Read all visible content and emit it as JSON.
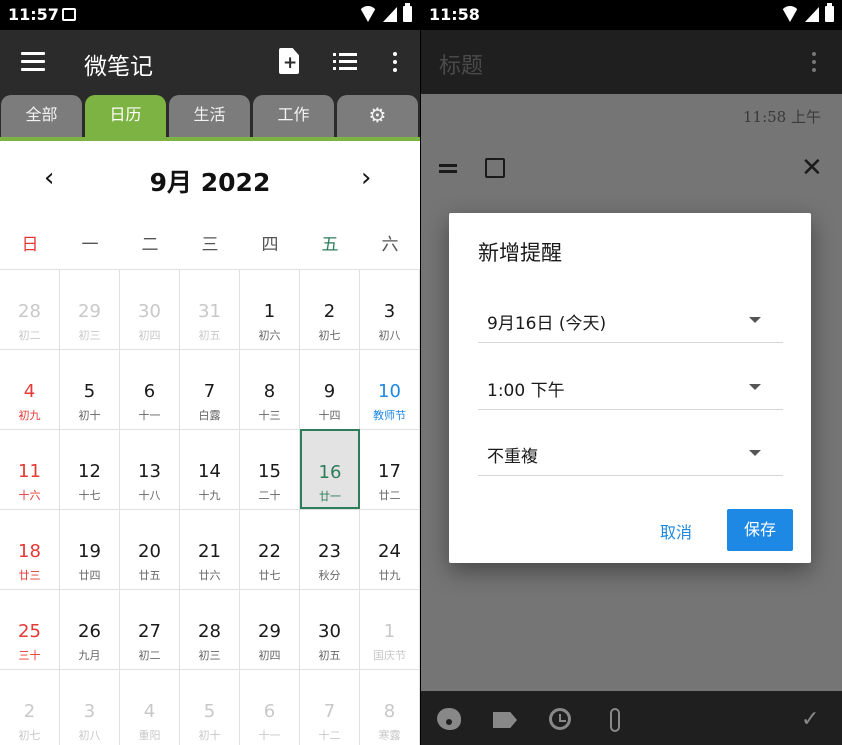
{
  "left": {
    "status": {
      "time": "11:57"
    },
    "app_title": "微笔记",
    "tabs": [
      {
        "label": "全部"
      },
      {
        "label": "日历",
        "active": true
      },
      {
        "label": "生活"
      },
      {
        "label": "工作"
      },
      {
        "label": "⚙",
        "icon": "gear-icon"
      }
    ],
    "month": {
      "prev": "‹",
      "title": "9月 2022",
      "next": "›"
    },
    "weekdays": [
      "日",
      "一",
      "二",
      "三",
      "四",
      "五",
      "六"
    ],
    "weekday_colors": {
      "sunday": "#e53935",
      "friday": "#2e7d5b"
    },
    "weeks": [
      [
        {
          "day": "28",
          "lunar": "初二",
          "other": true
        },
        {
          "day": "29",
          "lunar": "初三",
          "other": true
        },
        {
          "day": "30",
          "lunar": "初四",
          "other": true
        },
        {
          "day": "31",
          "lunar": "初五",
          "other": true
        },
        {
          "day": "1",
          "lunar": "初六"
        },
        {
          "day": "2",
          "lunar": "初七"
        },
        {
          "day": "3",
          "lunar": "初八"
        }
      ],
      [
        {
          "day": "4",
          "lunar": "初九",
          "sunday": true
        },
        {
          "day": "5",
          "lunar": "初十"
        },
        {
          "day": "6",
          "lunar": "十一"
        },
        {
          "day": "7",
          "lunar": "白露"
        },
        {
          "day": "8",
          "lunar": "十三"
        },
        {
          "day": "9",
          "lunar": "十四"
        },
        {
          "day": "10",
          "lunar": "教师节",
          "holiday": true
        }
      ],
      [
        {
          "day": "11",
          "lunar": "十六",
          "sunday": true
        },
        {
          "day": "12",
          "lunar": "十七"
        },
        {
          "day": "13",
          "lunar": "十八"
        },
        {
          "day": "14",
          "lunar": "十九"
        },
        {
          "day": "15",
          "lunar": "二十"
        },
        {
          "day": "16",
          "lunar": "廿一",
          "today": true
        },
        {
          "day": "17",
          "lunar": "廿二"
        }
      ],
      [
        {
          "day": "18",
          "lunar": "廿三",
          "sunday": true
        },
        {
          "day": "19",
          "lunar": "廿四"
        },
        {
          "day": "20",
          "lunar": "廿五"
        },
        {
          "day": "21",
          "lunar": "廿六"
        },
        {
          "day": "22",
          "lunar": "廿七"
        },
        {
          "day": "23",
          "lunar": "秋分"
        },
        {
          "day": "24",
          "lunar": "廿九"
        }
      ],
      [
        {
          "day": "25",
          "lunar": "三十",
          "sunday": true
        },
        {
          "day": "26",
          "lunar": "九月"
        },
        {
          "day": "27",
          "lunar": "初二"
        },
        {
          "day": "28",
          "lunar": "初三"
        },
        {
          "day": "29",
          "lunar": "初四"
        },
        {
          "day": "30",
          "lunar": "初五"
        },
        {
          "day": "1",
          "lunar": "国庆节",
          "other": true
        }
      ],
      [
        {
          "day": "2",
          "lunar": "初七",
          "other": true
        },
        {
          "day": "3",
          "lunar": "初八",
          "other": true
        },
        {
          "day": "4",
          "lunar": "重阳",
          "other": true
        },
        {
          "day": "5",
          "lunar": "初十",
          "other": true
        },
        {
          "day": "6",
          "lunar": "十一",
          "other": true
        },
        {
          "day": "7",
          "lunar": "十二",
          "other": true
        },
        {
          "day": "8",
          "lunar": "寒露",
          "other": true
        }
      ]
    ],
    "colors": {
      "accent": "#7cb342",
      "toolbar": "#2b2b2b",
      "today": "#2e7d5b",
      "sunday": "#e53935",
      "holiday": "#1e88e5"
    }
  },
  "right": {
    "status": {
      "time": "11:58"
    },
    "title_placeholder": "标题",
    "timestamp": "11:58 上午",
    "dialog": {
      "title": "新增提醒",
      "date": "9月16日 (今天)",
      "time": "1:00 下午",
      "repeat": "不重複",
      "cancel": "取消",
      "save": "保存"
    },
    "bottom_icons": [
      "palette-icon",
      "label-icon",
      "alarm-icon",
      "attach-icon",
      "check-icon"
    ],
    "colors": {
      "button": "#1e88e5",
      "overlay": "#757575"
    }
  }
}
